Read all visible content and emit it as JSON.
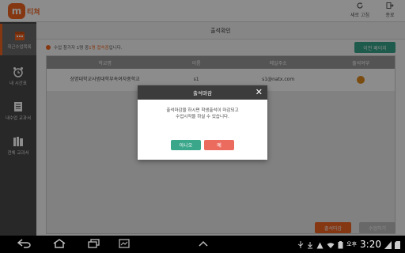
{
  "topbar": {
    "logo_mark": "m",
    "logo_text": "티쳐",
    "refresh_label": "새로 고침",
    "exit_label": "종료"
  },
  "sidebar": {
    "items": [
      {
        "label": "최근수업목록",
        "icon": "calendar-icon",
        "active": true
      },
      {
        "label": "내 시간표",
        "icon": "alarm-clock-icon",
        "active": false
      },
      {
        "label": "내수업 교과서",
        "icon": "notebook-icon",
        "active": false
      },
      {
        "label": "전체 교과서",
        "icon": "books-icon",
        "active": false
      }
    ]
  },
  "content": {
    "title": "출석확인",
    "notice_prefix": "수업 참가자 1명 중 ",
    "notice_highlight": "1명 접속중",
    "notice_suffix": "입니다.",
    "prev_page_label": "이전 페이지",
    "table": {
      "headers": [
        "학교명",
        "이름",
        "메일주소",
        "출석여부"
      ],
      "rows": [
        {
          "school": "상명대학교사범대학부속여자중학교",
          "name": "s1",
          "email": "s1@natx.com",
          "attended": true
        }
      ]
    },
    "close_attendance_label": "출석마감",
    "start_class_label": "수업하기"
  },
  "dialog": {
    "title": "출석마감",
    "message_line1": "출석마감을 하시면 학생출석이 마감되고",
    "message_line2": "수업시작을 하실 수 있습니다.",
    "no_label": "아니오",
    "yes_label": "예"
  },
  "navbar": {
    "ampm": "오후",
    "time": "3:20"
  },
  "colors": {
    "brand_orange": "#f26522",
    "teal": "#3aa68a",
    "red": "#ec6b5f",
    "sidebar_bg": "#4a4a4a"
  }
}
